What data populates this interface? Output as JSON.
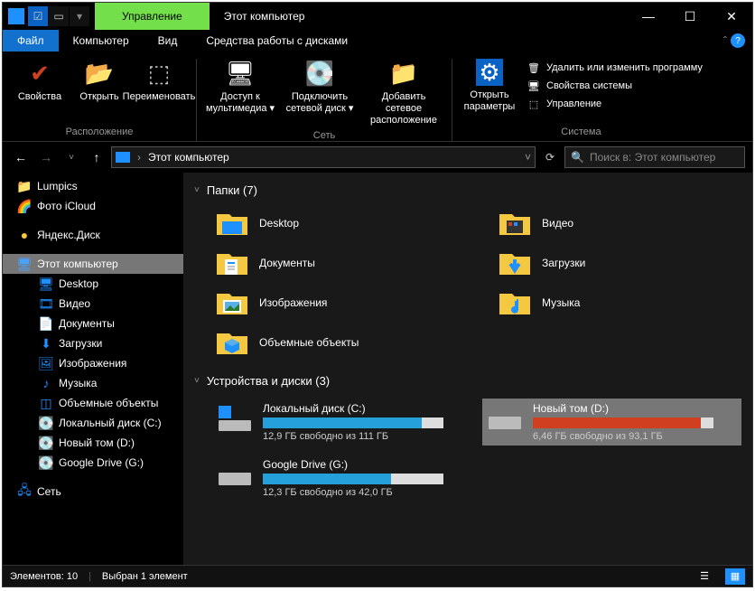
{
  "titlebar": {
    "manage": "Управление",
    "title": "Этот компьютер"
  },
  "tabs": {
    "file": "Файл",
    "computer": "Компьютер",
    "view": "Вид",
    "disk_tools": "Средства работы с дисками"
  },
  "ribbon": {
    "location": {
      "props": "Свойства",
      "open": "Открыть",
      "rename": "Переименовать",
      "label": "Расположение"
    },
    "network": {
      "media": "Доступ к мультимедиа",
      "mapdrive": "Подключить сетевой диск",
      "addloc": "Добавить сетевое расположение",
      "label": "Сеть"
    },
    "system": {
      "settings": "Открыть параметры",
      "uninstall": "Удалить или изменить программу",
      "sysprops": "Свойства системы",
      "manage": "Управление",
      "label": "Система"
    }
  },
  "addr": {
    "path": "Этот компьютер",
    "search_placeholder": "Поиск в: Этот компьютер"
  },
  "sidebar": {
    "lumpics": "Lumpics",
    "icloud": "Фото iCloud",
    "yadisk": "Яндекс.Диск",
    "thispc": "Этот компьютер",
    "desktop": "Desktop",
    "videos": "Видео",
    "documents": "Документы",
    "downloads": "Загрузки",
    "pictures": "Изображения",
    "music": "Музыка",
    "objects3d": "Объемные объекты",
    "localdisk": "Локальный диск (C:)",
    "newvol": "Новый том (D:)",
    "gdrive": "Google Drive (G:)",
    "network": "Сеть"
  },
  "content": {
    "folders_hdr": "Папки (7)",
    "folders": {
      "desktop": "Desktop",
      "videos": "Видео",
      "documents": "Документы",
      "downloads": "Загрузки",
      "pictures": "Изображения",
      "music": "Музыка",
      "objects3d": "Объемные объекты"
    },
    "drives_hdr": "Устройства и диски (3)",
    "drives": {
      "c": {
        "name": "Локальный диск (C:)",
        "sub": "12,9 ГБ свободно из 111 ГБ",
        "pct": 88
      },
      "d": {
        "name": "Новый том (D:)",
        "sub": "6,46 ГБ свободно из 93,1 ГБ",
        "pct": 93
      },
      "g": {
        "name": "Google Drive (G:)",
        "sub": "12,3 ГБ свободно из 42,0 ГБ",
        "pct": 71
      }
    }
  },
  "status": {
    "count": "Элементов: 10",
    "sel": "Выбран 1 элемент"
  }
}
